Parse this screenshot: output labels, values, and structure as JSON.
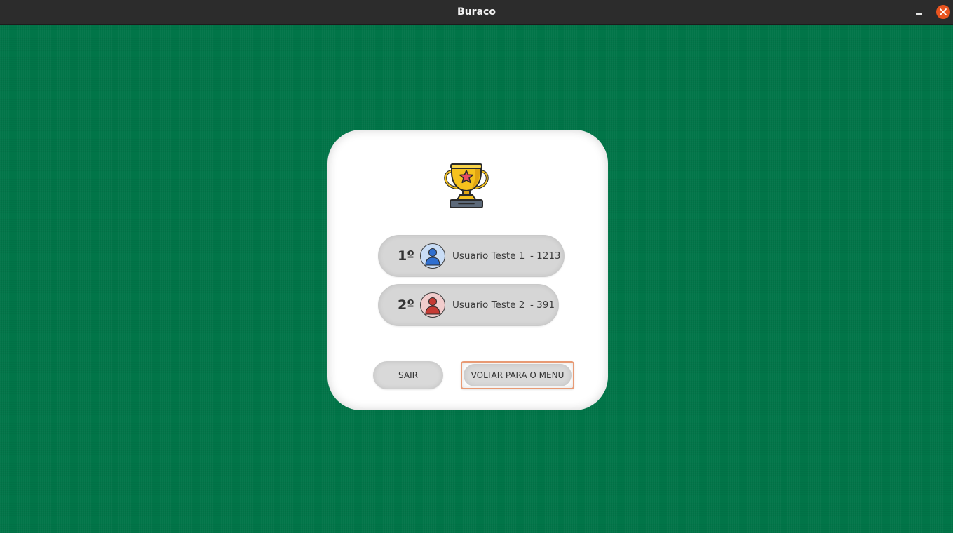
{
  "window": {
    "title": "Buraco",
    "close_color": "#e9541f"
  },
  "theme": {
    "felt_color": "#017548",
    "panel_color": "#ffffff",
    "accent_border": "#e89a74"
  },
  "results": {
    "icon": "trophy-icon",
    "ranking": [
      {
        "position": "1º",
        "avatar_icon": "user-icon",
        "avatar_color": "#2f6fd0",
        "name": "Usuario Teste 1",
        "score": "- 1213"
      },
      {
        "position": "2º",
        "avatar_icon": "user-icon",
        "avatar_color": "#c63b34",
        "name": "Usuario Teste 2",
        "score": "- 391"
      }
    ]
  },
  "actions": {
    "exit_label": "SAIR",
    "menu_label": "VOLTAR PARA O MENU"
  }
}
